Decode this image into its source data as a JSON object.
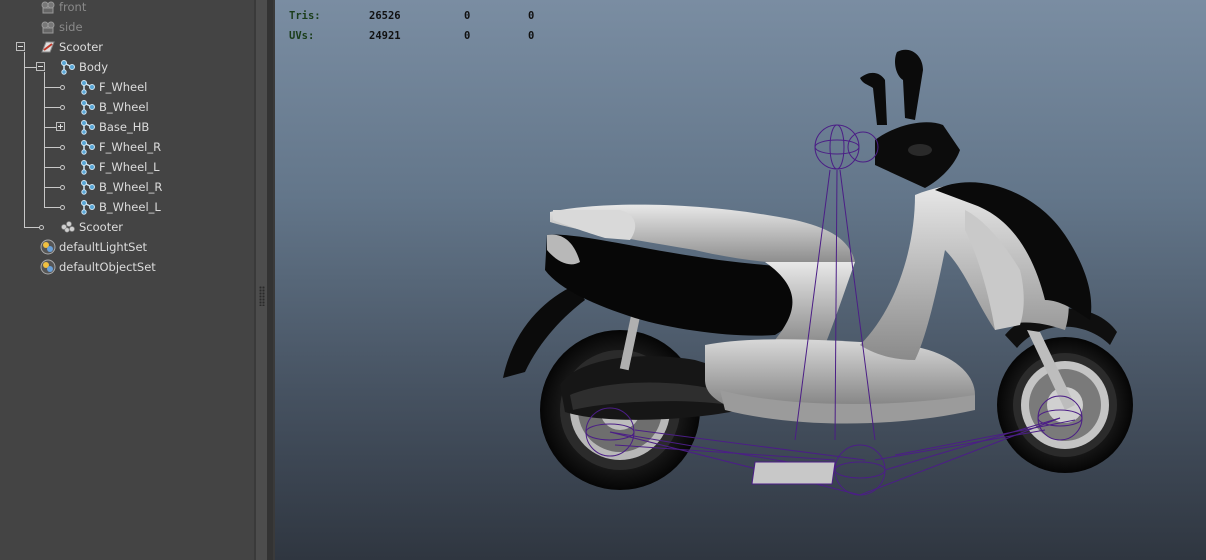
{
  "outliner": {
    "items": [
      {
        "label": "front",
        "icon": "camera-icon"
      },
      {
        "label": "side",
        "icon": "camera-icon"
      },
      {
        "label": "Scooter",
        "icon": "group-transform-icon"
      },
      {
        "label": "Body",
        "icon": "joint-icon"
      },
      {
        "label": "F_Wheel",
        "icon": "joint-icon"
      },
      {
        "label": "B_Wheel",
        "icon": "joint-icon"
      },
      {
        "label": "Base_HB",
        "icon": "joint-icon"
      },
      {
        "label": "F_Wheel_R",
        "icon": "joint-icon"
      },
      {
        "label": "F_Wheel_L",
        "icon": "joint-icon"
      },
      {
        "label": "B_Wheel_R",
        "icon": "joint-icon"
      },
      {
        "label": "B_Wheel_L",
        "icon": "joint-icon"
      },
      {
        "label": "Scooter",
        "icon": "mesh-icon"
      },
      {
        "label": "defaultLightSet",
        "icon": "set-icon"
      },
      {
        "label": "defaultObjectSet",
        "icon": "set-icon"
      }
    ]
  },
  "hud": {
    "rows": [
      {
        "key": "Tris:",
        "values": [
          "26526",
          "0",
          "0"
        ]
      },
      {
        "key": "UVs:",
        "values": [
          "24921",
          "0",
          "0"
        ]
      }
    ]
  },
  "colors": {
    "panel_bg": "#444444",
    "hud_key": "#1a3d1a",
    "rig_wire": "#4b1e86",
    "viewport_top": "#7a8da2",
    "viewport_bottom": "#2f3640"
  }
}
